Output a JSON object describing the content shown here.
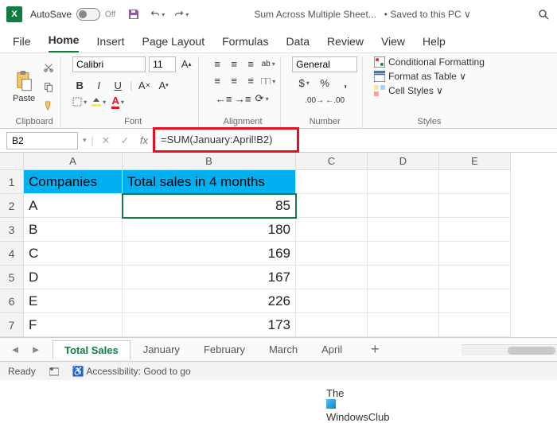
{
  "titlebar": {
    "autosave_label": "AutoSave",
    "autosave_state": "Off",
    "doc_name": "Sum Across Multiple Sheet...",
    "save_status": "• Saved to this PC ∨"
  },
  "menu": [
    "File",
    "Home",
    "Insert",
    "Page Layout",
    "Formulas",
    "Data",
    "Review",
    "View",
    "Help"
  ],
  "menu_active": "Home",
  "ribbon": {
    "clipboard": {
      "paste": "Paste",
      "label": "Clipboard"
    },
    "font": {
      "name": "Calibri",
      "size": "11",
      "label": "Font"
    },
    "alignment": {
      "label": "Alignment"
    },
    "number": {
      "format": "General",
      "label": "Number"
    },
    "styles": {
      "conditional": "Conditional Formatting",
      "table": "Format as Table ∨",
      "cell": "Cell Styles ∨",
      "label": "Styles"
    }
  },
  "name_box": "B2",
  "formula": "=SUM(January:April!B2)",
  "columns": [
    "A",
    "B",
    "C",
    "D",
    "E"
  ],
  "rows": [
    "1",
    "2",
    "3",
    "4",
    "5",
    "6",
    "7"
  ],
  "headers": {
    "a": "Companies",
    "b": "Total sales in 4 months"
  },
  "data": [
    {
      "company": "A",
      "total": "85"
    },
    {
      "company": "B",
      "total": "180"
    },
    {
      "company": "C",
      "total": "169"
    },
    {
      "company": "D",
      "total": "167"
    },
    {
      "company": "E",
      "total": "226"
    },
    {
      "company": "F",
      "total": "173"
    }
  ],
  "tabs": [
    "Total Sales",
    "January",
    "February",
    "March",
    "April"
  ],
  "tabs_active": "Total Sales",
  "status": {
    "ready": "Ready",
    "access": "Accessibility: Good to go"
  },
  "watermark": {
    "l1": "The",
    "l2": "WindowsClub"
  }
}
